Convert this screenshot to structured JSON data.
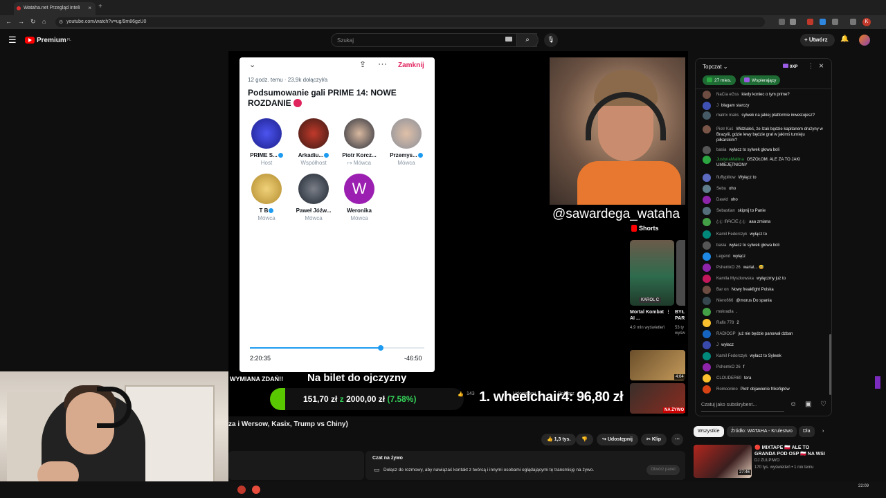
{
  "browser": {
    "tab_title": "Wataha.net Przegląd inteli",
    "url": "youtube.com/watch?v=ug/9m86gzU0"
  },
  "header": {
    "logo_text": "Premium",
    "logo_sup": "PL",
    "search_placeholder": "Szukaj",
    "create_label": "Utwórz"
  },
  "space": {
    "close_label": "Zamknij",
    "meta": "12 godz. temu · 23,9k dołączył/a",
    "title": "Podsumowanie gali PRIME 14: NOWE ROZDANIE",
    "speakers": [
      {
        "name": "PRIME S...",
        "role": "Host"
      },
      {
        "name": "Arkadiu...",
        "role": "Współhost"
      },
      {
        "name": "Piotr Korcz...",
        "role": "↦ Mówca"
      },
      {
        "name": "Przemys...",
        "role": "Mówca"
      },
      {
        "name": "T B",
        "role": "Mówca"
      },
      {
        "name": "Paweł Jóźw...",
        "role": "Mówca"
      },
      {
        "name": "Weronika",
        "role": "Mówca"
      }
    ],
    "avatar_letter": "W",
    "progress": 0.75,
    "time_elapsed": "2:20:35",
    "time_remaining": "-46:50"
  },
  "overlay": {
    "handle": "@sawardega_wataha",
    "banner_left": "WYMIANA ZDAŃ!!",
    "banner_right": "Na bilet do ojczyzny",
    "donation_current": "151,70 zł",
    "donation_sep": "z",
    "donation_goal": "2000,00 zł",
    "donation_pct": "(7.58%)",
    "leader": "1. wheelchair4: 96,80 zł",
    "ghost_count": "143",
    "ghost_share": "Udostępnij",
    "ghost_more": "Pobierz"
  },
  "shorts": {
    "title": "Shorts",
    "item1_tag": "KAROL C",
    "item1_title": "Mortal Kombat AI ...",
    "item1_views": "4,9 mln wyświetleń",
    "item2_title": "BYŁ PAR",
    "item2_views": "53 ty wyświ",
    "rec1_dur": "4:04",
    "rec2_live": "NA ŻYWO"
  },
  "chat": {
    "top_label": "Topczat",
    "xp": "0XP",
    "pill1": "27 mies.",
    "pill2": "Wspierający",
    "messages": [
      {
        "author": "NaCia eGss",
        "text": "kiedy koniec o tym prime?"
      },
      {
        "author": "J",
        "text": "błagam starczy"
      },
      {
        "author": "matrix maks",
        "text": "sylwek na jakiej platformie inwestujesz?"
      },
      {
        "author": "Piotr Kuś",
        "text": "Widziałeś, że Izak będzie kapitanem drużyny w Brazylii, gdzie lewy będzie grał w jakimś turnieju piłkarskim?"
      },
      {
        "author": "basia",
        "text": "wyłacz to sylwek głowa boli"
      },
      {
        "author": "JustynaMallina",
        "text": "OSZOŁOM. ALE ZA TO JAKI UMIEJĘTNIONY"
      },
      {
        "author": "fluffypillow",
        "text": "Wyłącz to"
      },
      {
        "author": "Sebu",
        "text": "oho"
      },
      {
        "author": "Dawid",
        "text": "oho"
      },
      {
        "author": "Sebastian",
        "text": "skipnij to Panie"
      },
      {
        "author": "ꦿꦿ ᗰᗩᑕIᗴ ꦿꦿ",
        "text": "aaa zmiana"
      },
      {
        "author": "Kamil Fedorczyk",
        "text": "wyłącz to"
      },
      {
        "author": "basia",
        "text": "wyłacz to sylwek głowa boli"
      },
      {
        "author": "Legend",
        "text": "wyłącz"
      },
      {
        "author": "PshemkO 26",
        "text": "wariat... 😅"
      },
      {
        "author": "Kamila Myszkowska",
        "text": "wyłączmy już to"
      },
      {
        "author": "Bar on",
        "text": "Nowy freakfight Polska"
      },
      {
        "author": "Niero666",
        "text": "@morus Do spania"
      },
      {
        "author": "mokradla",
        "text": "."
      },
      {
        "author": "Rafix 778",
        "text": "2"
      },
      {
        "author": "RADIOGP",
        "text": "już nie będzie panował dzban"
      },
      {
        "author": "J",
        "text": "wyłacz"
      },
      {
        "author": "Kamil Fedorczyk",
        "text": "wyłacz to Sylwek"
      },
      {
        "author": "PshemkO 26",
        "text": "f"
      },
      {
        "author": "CLOUDER60",
        "text": "tera"
      },
      {
        "author": "Romoonino",
        "text": "Piotr objawienie frikefigtów"
      }
    ],
    "input_placeholder": "Czatuj jako subskrybent..."
  },
  "below": {
    "title_fragment": "za i Wersow, Kasix, Trump vs Chiny)",
    "likes": "1,3 tys.",
    "share": "Udostępnij",
    "clip": "Klip",
    "live_chat_title": "Czat na żywo",
    "live_chat_desc": "Dołącz do rozmowy, aby nawiązać kontakt z twórcą i innymi osobami oglądającymi tę transmisję na żywo.",
    "live_chat_btn": "Otwórz panel"
  },
  "recs": {
    "chips": [
      "Wszystkie",
      "Źródło: WATAHA - Krulestwo",
      "Dla"
    ],
    "item_title": "🔴 MIXTAPE 🇵🇱 ALE TO GRANDA POD OSP 🇵🇱 NA WSI",
    "item_channel": "DJ ZULPIWO",
    "item_views": "170 tys. wyświetleń • 1 rok temu",
    "item_dur": "27:46"
  },
  "taskbar": {
    "time": "22:09"
  }
}
